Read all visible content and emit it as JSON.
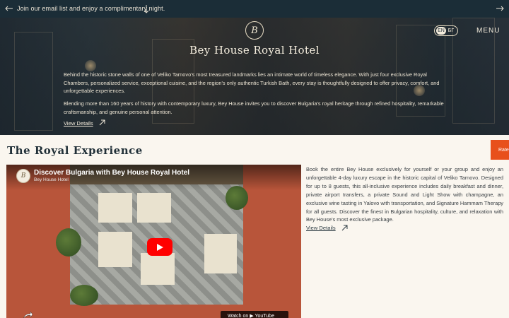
{
  "announcement": {
    "text": "Join our email list and enjoy a complimentary night.",
    "left_icon": "arrow-left-icon",
    "right_icon": "arrow-right-icon",
    "down_icon": "arrow-down-icon"
  },
  "header": {
    "logo_letter": "B",
    "lang_active": "EN",
    "lang_other": "БГ",
    "menu_label": "MENU"
  },
  "hero": {
    "title": "Bey House Royal Hotel",
    "paragraph1": "Behind the historic stone walls of one of Veliko Tarnovo's most treasured landmarks lies an intimate world of timeless elegance. With just four exclusive Royal Chambers, personalized service, exceptional cuisine, and the region's only authentic Turkish Bath, every stay is thoughtfully designed to offer privacy, comfort, and unforgettable experiences.",
    "paragraph2": "Blending more than 160 years of history with contemporary luxury, Bey House invites you to discover Bulgaria's royal heritage through refined hospitality, remarkable craftsmanship, and genuine personal attention.",
    "link_label": "View Details"
  },
  "royal": {
    "title": "The Royal Experience",
    "rate_tab": "Rate",
    "video": {
      "title": "Discover Bulgaria with Bey House Royal Hotel",
      "channel": "Bey House Hotel",
      "channel_avatar_letter": "B",
      "watch_label": "Watch on  ▶ YouTube"
    },
    "description": "Book the entire Bey House exclusively for yourself or your group and enjoy an unforgettable 4-day luxury escape in the historic capital of Veliko Tarnovo. Designed for up to 8 guests, this all-inclusive experience includes daily breakfast and dinner, private airport transfers, a private Sound and Light Show with champagne, an exclusive wine tasting in Yalovo with transportation, and Signature Hammam Therapy for all guests. Discover the finest in Bulgarian hospitality, culture, and relaxation with Bey House's most exclusive package.",
    "link_label": "View Details"
  },
  "colors": {
    "announcement_bg": "#1b2d37",
    "page_bg": "#faf6ef",
    "accent_tab": "#e8501c",
    "youtube_red": "#ff0000"
  }
}
